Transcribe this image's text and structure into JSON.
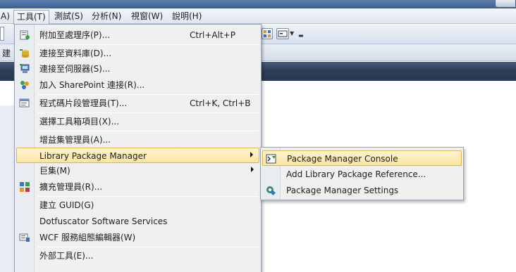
{
  "menubar": {
    "items": [
      {
        "label": "A)"
      },
      {
        "label": "工具(T)"
      },
      {
        "label": "測試(S)"
      },
      {
        "label": "分析(N)"
      },
      {
        "label": "視窗(W)"
      },
      {
        "label": "說明(H)"
      }
    ]
  },
  "toolbar_row2_text": "建",
  "tools_menu": {
    "items": [
      {
        "label": "附加至處理序(P)...",
        "shortcut": "Ctrl+Alt+P",
        "icon": "attach-process-icon"
      },
      {
        "label": "連接至資料庫(D)...",
        "icon": "database-connect-icon"
      },
      {
        "label": "連接至伺服器(S)...",
        "icon": "server-connect-icon"
      },
      {
        "label": "加入 SharePoint 連接(R)...",
        "icon": "sharepoint-icon"
      },
      {
        "label": "程式碼片段管理員(T)...",
        "shortcut": "Ctrl+K, Ctrl+B",
        "icon": "snippet-manager-icon"
      },
      {
        "label": "選擇工具箱項目(X)..."
      },
      {
        "label": "增益集管理員(A)..."
      },
      {
        "label": "Library Package Manager",
        "submenu": true
      },
      {
        "label": "巨集(M)",
        "submenu": true
      },
      {
        "label": "擴充管理員(R)...",
        "icon": "extension-manager-icon"
      },
      {
        "label": "建立 GUID(G)"
      },
      {
        "label": "Dotfuscator Software Services"
      },
      {
        "label": "WCF 服務組態編輯器(W)",
        "icon": "wcf-config-icon"
      },
      {
        "label": "外部工具(E)..."
      }
    ]
  },
  "package_submenu": {
    "items": [
      {
        "label": "Package Manager Console",
        "icon": "console-icon"
      },
      {
        "label": "Add Library Package Reference..."
      },
      {
        "label": "Package Manager Settings",
        "icon": "settings-icon"
      }
    ]
  },
  "colors": {
    "highlight": "#fbe59f",
    "highlight_border": "#e0b54c",
    "dark_band": "#2e3d57"
  }
}
